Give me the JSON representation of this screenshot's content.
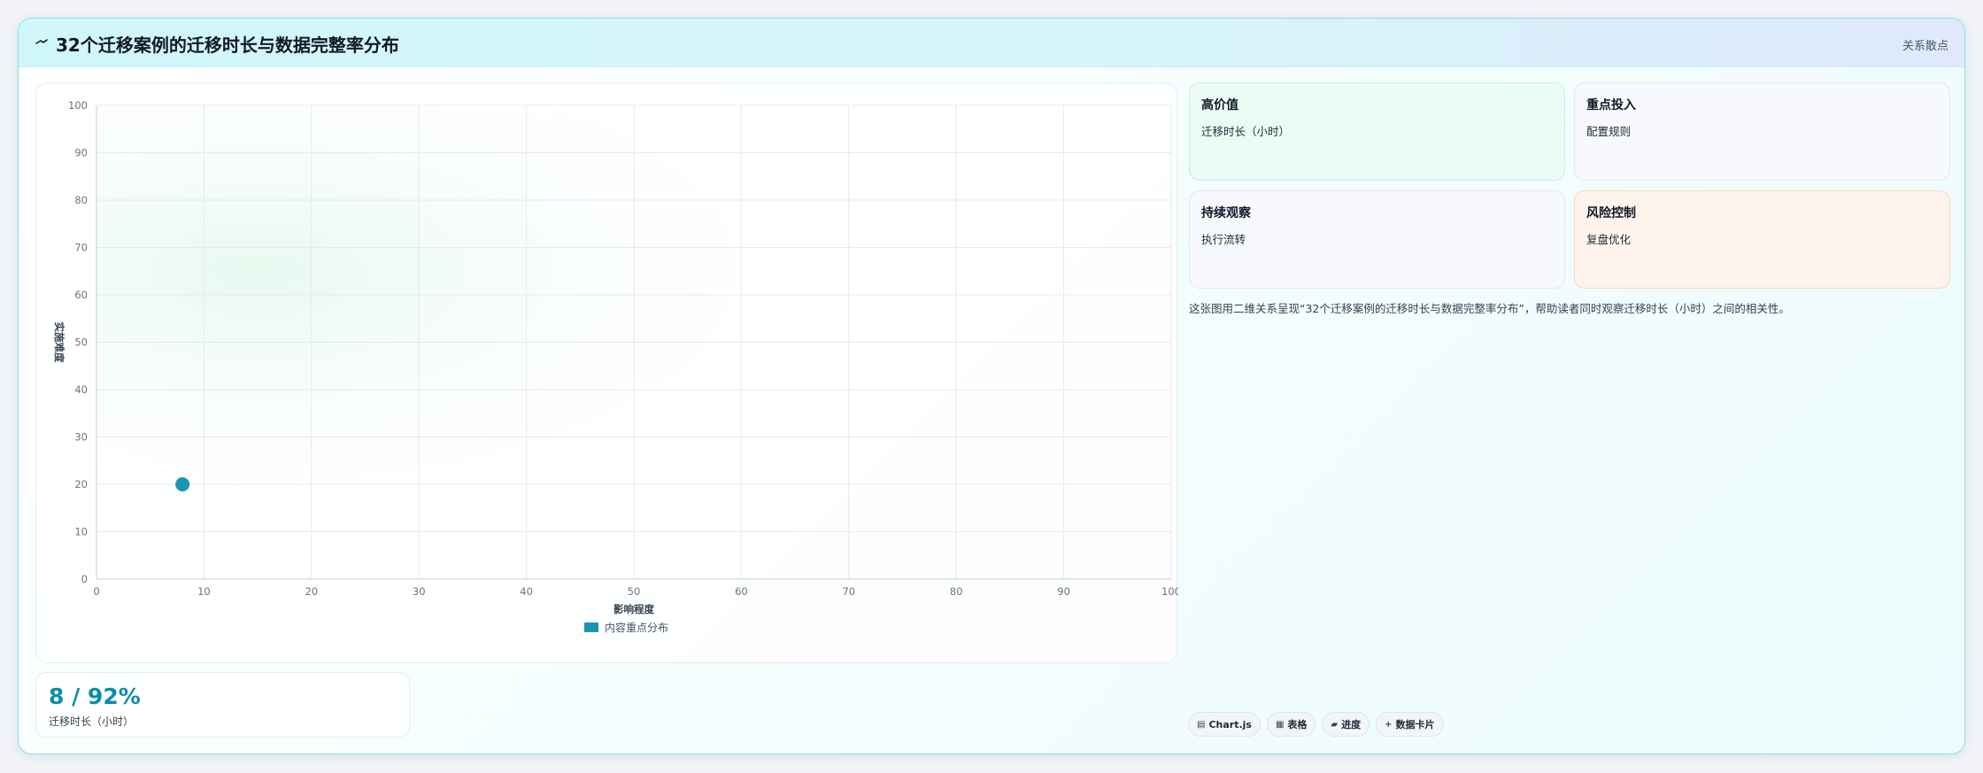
{
  "header": {
    "title": "32个迁移案例的迁移时长与数据完整率分布",
    "tag": "关系散点"
  },
  "chart_data": {
    "type": "scatter",
    "title": "",
    "xlabel": "影响程度",
    "ylabel": "实施难度",
    "xlim": [
      0,
      100
    ],
    "ylim": [
      0,
      100
    ],
    "xticks": [
      0,
      10,
      20,
      30,
      40,
      50,
      60,
      70,
      80,
      90,
      100
    ],
    "yticks": [
      0,
      10,
      20,
      30,
      40,
      50,
      60,
      70,
      80,
      90,
      100
    ],
    "grid": true,
    "legend_position": "bottom",
    "series": [
      {
        "name": "内容重点分布",
        "color": "#1a96b0",
        "points": [
          {
            "x": 8,
            "y": 20
          }
        ]
      }
    ]
  },
  "stat": {
    "value": "8 / 92%",
    "label": "迁移时长（小时）"
  },
  "quadrants": [
    {
      "title": "高价值",
      "subtitle": "迁移时长（小时）"
    },
    {
      "title": "重点投入",
      "subtitle": "配置规则"
    },
    {
      "title": "持续观察",
      "subtitle": "执行流转"
    },
    {
      "title": "风险控制",
      "subtitle": "复盘优化"
    }
  ],
  "description": "这张图用二维关系呈现“32个迁移案例的迁移时长与数据完整率分布”，帮助读者同时观察迁移时长（小时）之间的相关性。",
  "chips": [
    {
      "icon": "chart-icon",
      "glyph": "▤",
      "label": "Chart.js"
    },
    {
      "icon": "table-icon",
      "glyph": "▦",
      "label": "表格"
    },
    {
      "icon": "progress-icon",
      "glyph": "▰",
      "label": "进度"
    },
    {
      "icon": "plus-icon",
      "glyph": "+",
      "label": "数据卡片"
    }
  ],
  "colors": {
    "accent": "#0e8ca8",
    "point": "#1a96b0",
    "header_bg": "#d0f7fb",
    "quad_green": "#ebfbf4",
    "quad_orange": "#fef4eb"
  }
}
